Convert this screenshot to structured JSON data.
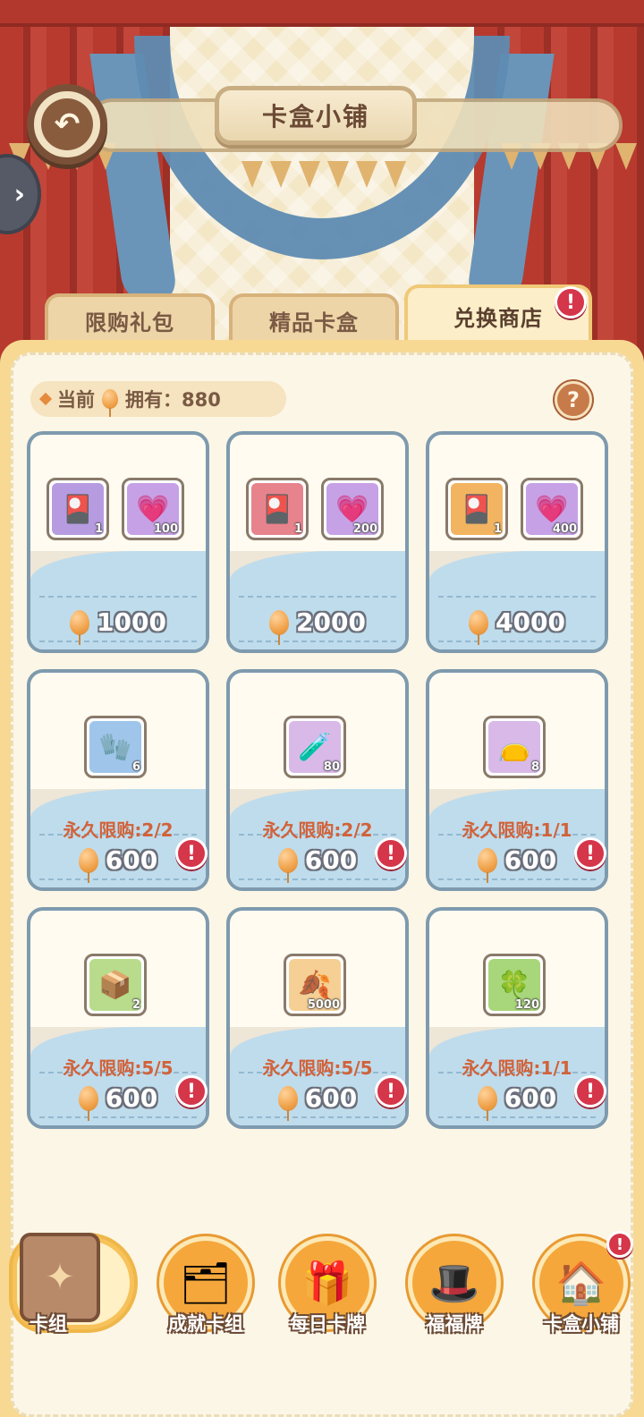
{
  "header": {
    "title": "卡盒小铺",
    "back_icon": "↶",
    "side_toggle_icon": "›"
  },
  "tabs": [
    {
      "label": "限购礼包",
      "active": false
    },
    {
      "label": "精品卡盒",
      "active": false
    },
    {
      "label": "兑换商店",
      "active": true,
      "alert": "!"
    }
  ],
  "balance": {
    "prefix": "当前",
    "suffix": "拥有：880",
    "currency_icon": "balloon-icon"
  },
  "help": {
    "label": "?"
  },
  "bundles": [
    {
      "items": [
        {
          "icon": "card-pack-icon",
          "qty": "1",
          "color": "#b79be0"
        },
        {
          "icon": "heart-crystal-icon",
          "qty": "100",
          "color": "#c7a1e6"
        }
      ],
      "price": "1000"
    },
    {
      "items": [
        {
          "icon": "card-pack-icon",
          "qty": "1",
          "color": "#e7838c"
        },
        {
          "icon": "heart-crystal-icon",
          "qty": "200",
          "color": "#c7a1e6"
        }
      ],
      "price": "2000"
    },
    {
      "items": [
        {
          "icon": "card-pack-icon",
          "qty": "1",
          "color": "#f2b460"
        },
        {
          "icon": "heart-crystal-icon",
          "qty": "400",
          "color": "#c7a1e6"
        }
      ],
      "price": "4000"
    }
  ],
  "shop_items": [
    {
      "icon": "glove-icon",
      "glyph": "🧤",
      "qty": "6",
      "bg": "#9fc6ea",
      "limit": "永久限购:2/2",
      "price": "600",
      "alert": "!"
    },
    {
      "icon": "potion-icon",
      "glyph": "🧪",
      "qty": "80",
      "bg": "#d9b9e8",
      "limit": "永久限购:2/2",
      "price": "600",
      "alert": "!"
    },
    {
      "icon": "cloth-bag-icon",
      "glyph": "👝",
      "qty": "8",
      "bg": "#d9b9e8",
      "limit": "永久限购:1/1",
      "price": "600",
      "alert": "!"
    },
    {
      "icon": "box-icon",
      "glyph": "📦",
      "qty": "2",
      "bg": "#b8dc8c",
      "limit": "永久限购:5/5",
      "price": "600",
      "alert": "!"
    },
    {
      "icon": "leaf-icon",
      "glyph": "🍂",
      "qty": "5000",
      "bg": "#f5cf93",
      "limit": "永久限购:5/5",
      "price": "600",
      "alert": "!"
    },
    {
      "icon": "clover-icon",
      "glyph": "🍀",
      "qty": "120",
      "bg": "#a8d67a",
      "limit": "永久限购:1/1",
      "price": "600",
      "alert": "!"
    }
  ],
  "bottom_nav": [
    {
      "label": "卡组",
      "icon": "card-book-icon",
      "glyph": "✦",
      "active": true
    },
    {
      "label": "成就卡组",
      "icon": "achievement-cards-icon",
      "glyph": "🗂"
    },
    {
      "label": "每日卡牌",
      "icon": "gift-box-icon",
      "glyph": "🎁"
    },
    {
      "label": "福福牌",
      "icon": "magic-hat-icon",
      "glyph": "🎩"
    },
    {
      "label": "卡盒小铺",
      "icon": "shop-house-icon",
      "glyph": "🏠",
      "alert": "!"
    }
  ]
}
